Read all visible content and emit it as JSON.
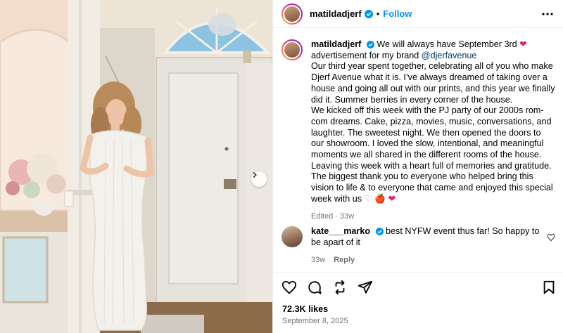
{
  "header": {
    "username": "matildadjerf",
    "separator": "•",
    "follow_label": "Follow",
    "icons": {
      "verified": "verified-badge-icon",
      "more": "more-options-icon"
    }
  },
  "caption": {
    "username": "matildadjerf",
    "line1": "We will always have September 3rd",
    "line2_prefix": "advertisement for my brand ",
    "mention": "@djerfavenue",
    "p1": "Our third year spent together, celebrating all of you who make Djerf Avenue what it is. I’ve always dreamed of taking over a house and going all out with our prints, and this year we finally did it. Summer berries in every corner of the house.",
    "p2": "We kicked off this week with the PJ party of our 2000s rom-com dreams. Cake, pizza, movies, music, conversations, and laughter. The sweetest night. We then opened the doors to our showroom. I loved the slow, intentional, and meaningful moments we all shared in the different rooms of the house.",
    "p3": "Leaving this week with a heart full of memories and gratitude. The biggest thank you to everyone who helped bring this vision to life & to everyone that came and enjoyed this special week with us",
    "emoji_heart": "❤",
    "emoji_white_heart": "♡",
    "emoji_apple": "🍎",
    "meta": "Edited · 33w"
  },
  "comment": {
    "username": "kate___marko",
    "text": "best NYFW event thus far! So happy to be apart of it",
    "time": "33w",
    "reply_label": "Reply"
  },
  "actions": {
    "icons": [
      "heart-icon",
      "comment-icon",
      "share-icon",
      "send-icon",
      "bookmark-icon"
    ],
    "likes": "72.3K likes",
    "date": "September 8, 2025"
  },
  "colors": {
    "accent": "#0095f6",
    "mention": "#00376b",
    "meta_text": "#737373",
    "heart": "#e0245e",
    "divider": "#efefef"
  }
}
